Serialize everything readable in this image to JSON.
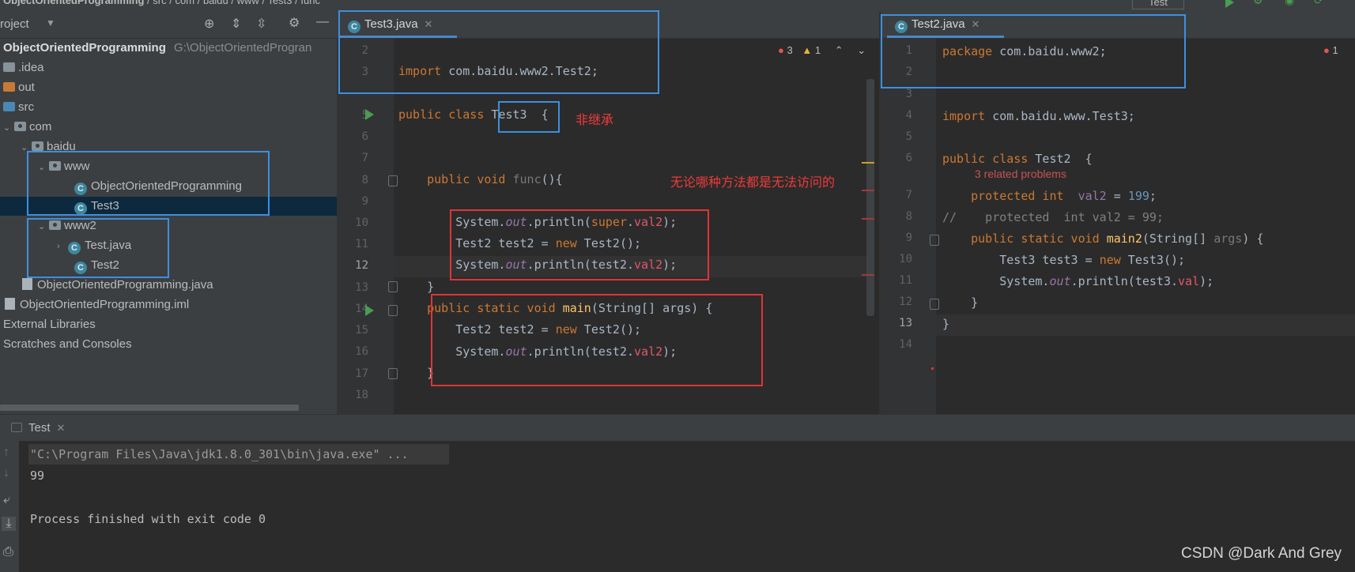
{
  "breadcrumb": {
    "items": [
      "ObjectOrientedProgramming",
      "src",
      "com",
      "baidu",
      "www",
      "Test3",
      "func"
    ],
    "separator": "/",
    "run_config": "Test"
  },
  "project": {
    "header_label": "roject",
    "root": {
      "name": "ObjectOrientedProgramming",
      "path": "G:\\ObjectOrientedProgran"
    },
    "items": [
      {
        "label": ".idea"
      },
      {
        "label": "out"
      },
      {
        "label": "src"
      },
      {
        "label": "com"
      },
      {
        "label": "baidu"
      },
      {
        "label": "www"
      },
      {
        "label": "ObjectOrientedProgramming"
      },
      {
        "label": "Test3"
      },
      {
        "label": "www2"
      },
      {
        "label": "Test.java"
      },
      {
        "label": "Test2"
      },
      {
        "label": "ObjectOrientedProgramming.java"
      },
      {
        "label": "ObjectOrientedProgramming.iml"
      },
      {
        "label": "External Libraries"
      },
      {
        "label": "Scratches and Consoles"
      }
    ]
  },
  "editor_left": {
    "tab": "Test3.java",
    "inspections": {
      "errors": "3",
      "warnings": "1"
    },
    "line_numbers": [
      "2",
      "3",
      "5",
      "6",
      "7",
      "8",
      "9",
      "10",
      "11",
      "12",
      "13",
      "14",
      "15",
      "16",
      "17",
      "18"
    ],
    "annotation_inherit": "非继承",
    "annotation_access": "无论哪种方法都是无法访问的"
  },
  "editor_right": {
    "tab": "Test2.java",
    "inspections": {
      "errors": "1"
    },
    "line_numbers": [
      "1",
      "2",
      "3",
      "4",
      "5",
      "6",
      "7",
      "8",
      "9",
      "10",
      "11",
      "12",
      "13",
      "14"
    ],
    "related_problems": "3 related problems"
  },
  "console": {
    "tab": "Test",
    "lines": [
      "\"C:\\Program Files\\Java\\jdk1.8.0_301\\bin\\java.exe\" ...",
      "99",
      "",
      "Process finished with exit code 0"
    ]
  },
  "watermark": "CSDN @Dark And Grey"
}
